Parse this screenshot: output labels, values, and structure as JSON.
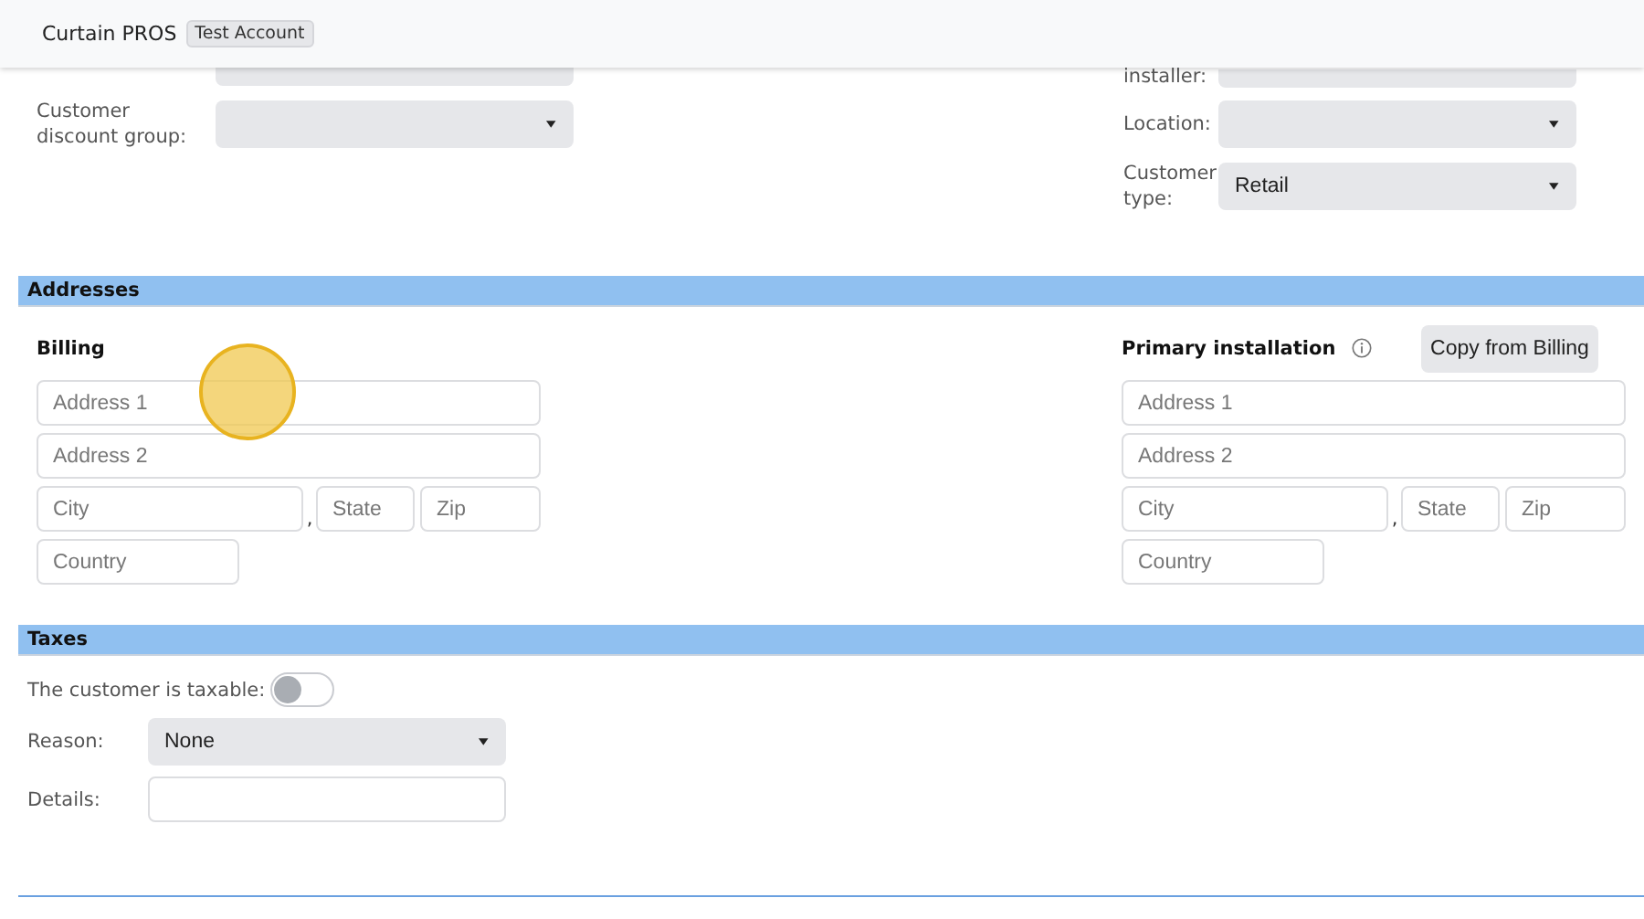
{
  "header": {
    "title": "Curtain PROS",
    "badge": "Test Account"
  },
  "customer": {
    "left": [
      {
        "kind": "cut"
      },
      {
        "kind": "select",
        "label": "Customer discount group:"
      }
    ],
    "right": [
      {
        "kind": "cut",
        "label": "installer:"
      },
      {
        "kind": "select",
        "label": "Location:"
      },
      {
        "kind": "select",
        "label": "Customer type:",
        "value": "Retail"
      }
    ]
  },
  "addresses": {
    "title": "Addresses",
    "blocks": [
      {
        "title": "Billing",
        "info": false,
        "address1": {
          "placeholder": "Address 1"
        },
        "address2": {
          "placeholder": "Address 2"
        },
        "city": {
          "placeholder": "City"
        },
        "separator": ",",
        "state": {
          "placeholder": "State"
        },
        "zip": {
          "placeholder": "Zip"
        },
        "country": {
          "placeholder": "Country"
        }
      },
      {
        "title": "Primary installation",
        "info": true,
        "button": "Copy from Billing",
        "address1": {
          "placeholder": "Address 1"
        },
        "address2": {
          "placeholder": "Address 2"
        },
        "city": {
          "placeholder": "City"
        },
        "separator": ",",
        "state": {
          "placeholder": "State"
        },
        "zip": {
          "placeholder": "Zip"
        },
        "country": {
          "placeholder": "Country"
        }
      }
    ]
  },
  "taxes": {
    "title": "Taxes",
    "taxable": {
      "label": "The customer is taxable:",
      "on": false
    },
    "reason": {
      "label": "Reason:",
      "value": "None"
    },
    "details": {
      "label": "Details:"
    }
  }
}
